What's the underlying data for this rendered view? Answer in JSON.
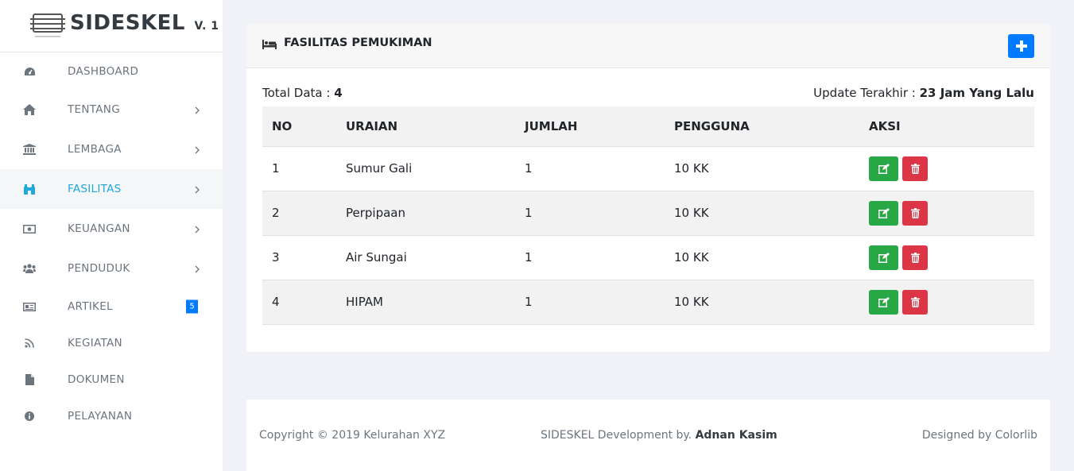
{
  "brand": {
    "name": "SIDESKEL",
    "version": "V. 1",
    "logo_text": "SIDESKEL"
  },
  "sidebar": {
    "items": [
      {
        "label": "DASHBOARD",
        "icon": "tachometer-icon"
      },
      {
        "label": "TENTANG",
        "icon": "home-icon"
      },
      {
        "label": "LEMBAGA",
        "icon": "institution-icon"
      },
      {
        "label": "FASILITAS",
        "icon": "binoculars-icon",
        "active": true
      },
      {
        "label": "KEUANGAN",
        "icon": "money-icon"
      },
      {
        "label": "PENDUDUK",
        "icon": "users-icon"
      },
      {
        "label": "ARTIKEL",
        "icon": "newspaper-icon",
        "badge": "5"
      },
      {
        "label": "KEGIATAN",
        "icon": "rss-icon"
      },
      {
        "label": "DOKUMEN",
        "icon": "file-icon"
      },
      {
        "label": "PELAYANAN",
        "icon": "info-circle-icon"
      }
    ]
  },
  "card": {
    "title": "FASILITAS PEMUKIMAN",
    "total_label": "Total Data : ",
    "total_value": "4",
    "updated_label": "Update Terakhir : ",
    "updated_value": "23 Jam Yang Lalu"
  },
  "table": {
    "headers": [
      "NO",
      "URAIAN",
      "JUMLAH",
      "PENGGUNA",
      "AKSI"
    ],
    "rows": [
      [
        "1",
        "Sumur Gali",
        "1",
        "10 KK"
      ],
      [
        "2",
        "Perpipaan",
        "1",
        "10 KK"
      ],
      [
        "3",
        "Air Sungai",
        "1",
        "10 KK"
      ],
      [
        "4",
        "HIPAM",
        "1",
        "10 KK"
      ]
    ]
  },
  "footer": {
    "copyright": "Copyright © 2019 Kelurahan XYZ",
    "dev_prefix": "SIDESKEL Development by. ",
    "dev_name": "Adnan Kasim",
    "design_prefix": "Designed by ",
    "design_name": "Colorlib"
  },
  "colors": {
    "accent": "#20a8d8",
    "primary": "#007bff",
    "success": "#28a745",
    "danger": "#dc3545"
  }
}
